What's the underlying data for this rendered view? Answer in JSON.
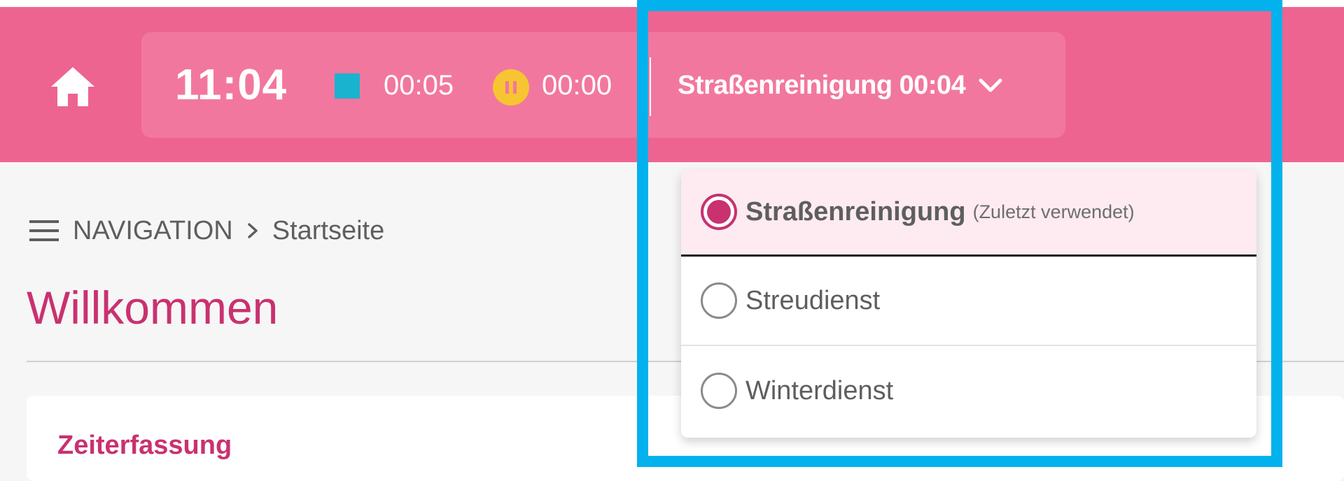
{
  "header": {
    "clock": "11:04",
    "work_time": "00:05",
    "pause_time": "00:00",
    "current_task_label": "Straßenreinigung 00:04",
    "colors": {
      "bar": "#ee6490",
      "panel": "#f2779e",
      "work": "#1ab3cf",
      "pause": "#f7c531"
    }
  },
  "breadcrumb": {
    "menu": "NAVIGATION",
    "current": "Startseite"
  },
  "page": {
    "title": "Willkommen",
    "card_title": "Zeiterfassung"
  },
  "dropdown": {
    "options": [
      {
        "label": "Straßenreinigung",
        "note": "(Zuletzt verwendet)",
        "selected": true
      },
      {
        "label": "Streudienst",
        "note": "",
        "selected": false
      },
      {
        "label": "Winterdienst",
        "note": "",
        "selected": false
      }
    ]
  },
  "icons": {
    "home": "home-icon",
    "menu": "hamburger-menu-icon",
    "chevron": "chevron-down-icon",
    "work": "work-square-icon",
    "pause": "pause-icon"
  },
  "highlight_color": "#03b2ec"
}
